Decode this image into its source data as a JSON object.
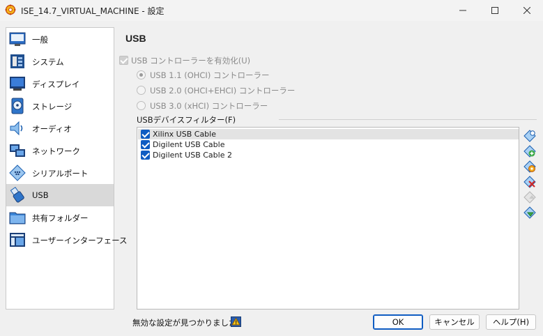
{
  "window": {
    "title": "ISE_14.7_VIRTUAL_MACHINE - 設定",
    "minimize": "—",
    "maximize": "☐",
    "close": "✕"
  },
  "sidebar": {
    "items": [
      {
        "label": "一般",
        "icon": "general-icon"
      },
      {
        "label": "システム",
        "icon": "system-icon"
      },
      {
        "label": "ディスプレイ",
        "icon": "display-icon"
      },
      {
        "label": "ストレージ",
        "icon": "storage-icon"
      },
      {
        "label": "オーディオ",
        "icon": "audio-icon"
      },
      {
        "label": "ネットワーク",
        "icon": "network-icon"
      },
      {
        "label": "シリアルポート",
        "icon": "serial-port-icon"
      },
      {
        "label": "USB",
        "icon": "usb-icon",
        "selected": true
      },
      {
        "label": "共有フォルダー",
        "icon": "shared-folder-icon"
      },
      {
        "label": "ユーザーインターフェース",
        "icon": "user-interface-icon"
      }
    ]
  },
  "main": {
    "title": "USB",
    "enable_usb_label": "USB コントローラーを有効化(U)",
    "controllers": [
      {
        "label": "USB 1.1 (OHCI) コントローラー",
        "selected": true
      },
      {
        "label": "USB 2.0 (OHCI+EHCI) コントローラー",
        "selected": false
      },
      {
        "label": "USB 3.0 (xHCI) コントローラー",
        "selected": false
      }
    ],
    "filter_label": "USBデバイスフィルター(F)",
    "filters": [
      {
        "name": "Xilinx USB Cable",
        "checked": true,
        "selected": true
      },
      {
        "name": "Digilent USB Cable",
        "checked": true,
        "selected": false
      },
      {
        "name": "Digilent USB Cable 2",
        "checked": true,
        "selected": false
      }
    ],
    "tools": [
      "add-filter-icon",
      "add-from-device-icon",
      "edit-filter-icon",
      "remove-filter-icon",
      "move-up-icon",
      "move-down-icon"
    ]
  },
  "footer": {
    "warning_text": "無効な設定が見つかりました",
    "ok_label": "OK",
    "cancel_label": "キャンセル",
    "help_label": "ヘルプ(H)"
  },
  "colors": {
    "accent": "#0f5cc2",
    "selected_row": "#d9d9d9",
    "background": "#f0f0f0"
  }
}
